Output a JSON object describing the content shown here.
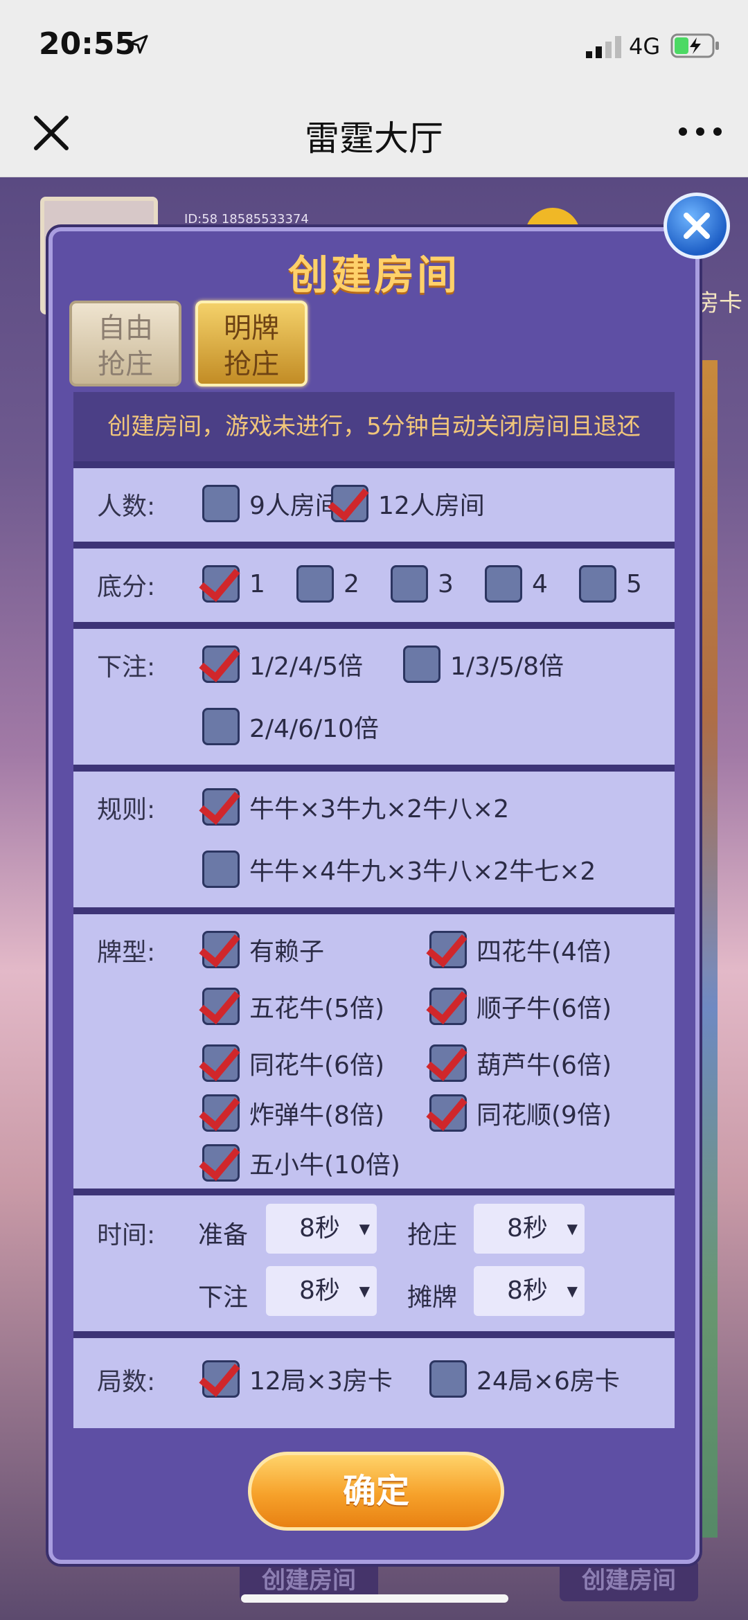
{
  "status_bar": {
    "time": "20:55",
    "network": "4G"
  },
  "titlebar": {
    "title": "雷霆大厅"
  },
  "background": {
    "player_name": "ID:58 18585533374",
    "room_card": "房卡",
    "create_btn_left": "创建房间",
    "create_btn_right": "创建房间"
  },
  "dialog": {
    "title": "创建房间",
    "modes": [
      {
        "line1": "自由",
        "line2": "抢庄",
        "selected": false
      },
      {
        "line1": "明牌",
        "line2": "抢庄",
        "selected": true
      }
    ],
    "notice": "创建房间，游戏未进行，5分钟自动关闭房间且退还",
    "players": {
      "label": "人数:",
      "options": [
        {
          "text": "9人房间",
          "checked": false
        },
        {
          "text": "12人房间",
          "checked": true
        }
      ]
    },
    "base_score": {
      "label": "底分:",
      "options": [
        {
          "text": "1",
          "checked": true
        },
        {
          "text": "2",
          "checked": false
        },
        {
          "text": "3",
          "checked": false
        },
        {
          "text": "4",
          "checked": false
        },
        {
          "text": "5",
          "checked": false
        }
      ]
    },
    "bet": {
      "label": "下注:",
      "options": [
        {
          "text": "1/2/4/5倍",
          "checked": true
        },
        {
          "text": "1/3/5/8倍",
          "checked": false
        },
        {
          "text": "2/4/6/10倍",
          "checked": false
        }
      ]
    },
    "rules": {
      "label": "规则:",
      "options": [
        {
          "text": "牛牛×3牛九×2牛八×2",
          "checked": true
        },
        {
          "text": "牛牛×4牛九×3牛八×2牛七×2",
          "checked": false
        }
      ]
    },
    "card_types": {
      "label": "牌型:",
      "options": [
        {
          "text": "有赖子",
          "checked": true
        },
        {
          "text": "四花牛(4倍)",
          "checked": true
        },
        {
          "text": "五花牛(5倍)",
          "checked": true
        },
        {
          "text": "顺子牛(6倍)",
          "checked": true
        },
        {
          "text": "同花牛(6倍)",
          "checked": true
        },
        {
          "text": "葫芦牛(6倍)",
          "checked": true
        },
        {
          "text": "炸弹牛(8倍)",
          "checked": true
        },
        {
          "text": "同花顺(9倍)",
          "checked": true
        },
        {
          "text": "五小牛(10倍)",
          "checked": true
        }
      ]
    },
    "time": {
      "label": "时间:",
      "fields": [
        {
          "label": "准备",
          "value": "8秒"
        },
        {
          "label": "抢庄",
          "value": "8秒"
        },
        {
          "label": "下注",
          "value": "8秒"
        },
        {
          "label": "摊牌",
          "value": "8秒"
        }
      ]
    },
    "rounds": {
      "label": "局数:",
      "options": [
        {
          "text": "12局×3房卡",
          "checked": true
        },
        {
          "text": "24局×6房卡",
          "checked": false
        }
      ]
    },
    "confirm_label": "确定"
  },
  "colors": {
    "dialog_bg": "#5e4fa4",
    "panel_bg": "#c1c0ef",
    "title_gold": "#ffd16a",
    "check_red": "#d0272b",
    "confirm_orange": "#f6a12a"
  }
}
